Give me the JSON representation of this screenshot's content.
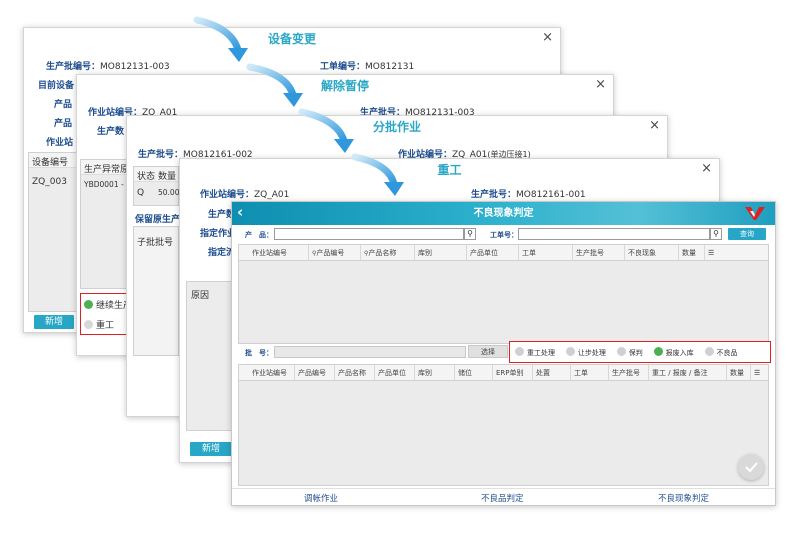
{
  "colors": {
    "accent": "#27a6c5",
    "label_blue": "#1f4e8f",
    "arrow_blue": "#3aa3e0",
    "highlight_red": "#e02020",
    "check_green": "#4caf50"
  },
  "dialog1": {
    "title": "设备变更",
    "close": "×",
    "batch_label": "生产批编号：",
    "batch_value": "MO812131-003",
    "order_label": "工单编号：",
    "order_value": "MO812131",
    "target_label": "目前设备",
    "product1_label": "产品",
    "product2_label": "产品",
    "station_label": "作业站",
    "col_equipment": "设备编号",
    "row_value": "ZQ_003",
    "add_button": "新增"
  },
  "dialog2": {
    "title": "解除暂停",
    "close": "×",
    "station_label": "作业站编号：",
    "station_value": "ZQ_A01",
    "batch_label": "生产批号：",
    "batch_value": "MO812131-003",
    "qty_label": "生产数",
    "col_reason": "生产异常原",
    "row_value": "YBD0001 - F",
    "opt_continue": "继续生产",
    "opt_rework": "重工"
  },
  "dialog3": {
    "title": "分批作业",
    "close": "×",
    "batch_label": "生产批号：",
    "batch_value": "MO812161-002",
    "station_label": "作业站编号：",
    "station_value": "ZQ_A01",
    "station_note": "(单边压接1)",
    "col_status": "状态",
    "col_qty": "数量",
    "row_status": "Q",
    "row_qty": "50.000",
    "keep_label": "保留原生产",
    "sub_batch": "子批批号"
  },
  "dialog4": {
    "title": "重工",
    "close": "×",
    "station_label": "作业站编号：",
    "station_value": "ZQ_A01",
    "batch_label": "生产批号：",
    "batch_value": "MO812161-001",
    "label_a": "生产数",
    "label_b": "指定作业",
    "label_c": "指定流",
    "reason": "原因",
    "add_button": "新增"
  },
  "front": {
    "back_icon": "‹",
    "title": "不良现象判定",
    "product_label": "产　品：",
    "order_label": "工单号：",
    "query_button": "查询",
    "top_columns": [
      "作业站编号",
      "产品编号",
      "产品名称",
      "库别",
      "产品单位",
      "工单",
      "生产批号",
      "不良现象",
      "数量"
    ],
    "batch_label": "批　号：",
    "select_button": "选择",
    "options": [
      "重工处理",
      "让步处理",
      "保判",
      "报废入库",
      "不良品"
    ],
    "bottom_columns": [
      "作业站编号",
      "产品编号",
      "产品名称",
      "产品单位",
      "库别",
      "储位",
      "ERP单别",
      "处置",
      "工单",
      "生产批号",
      "重工 / 报废 / 备注",
      "数量"
    ],
    "nav": [
      "调帐作业",
      "不良品判定",
      "不良现象判定"
    ]
  }
}
